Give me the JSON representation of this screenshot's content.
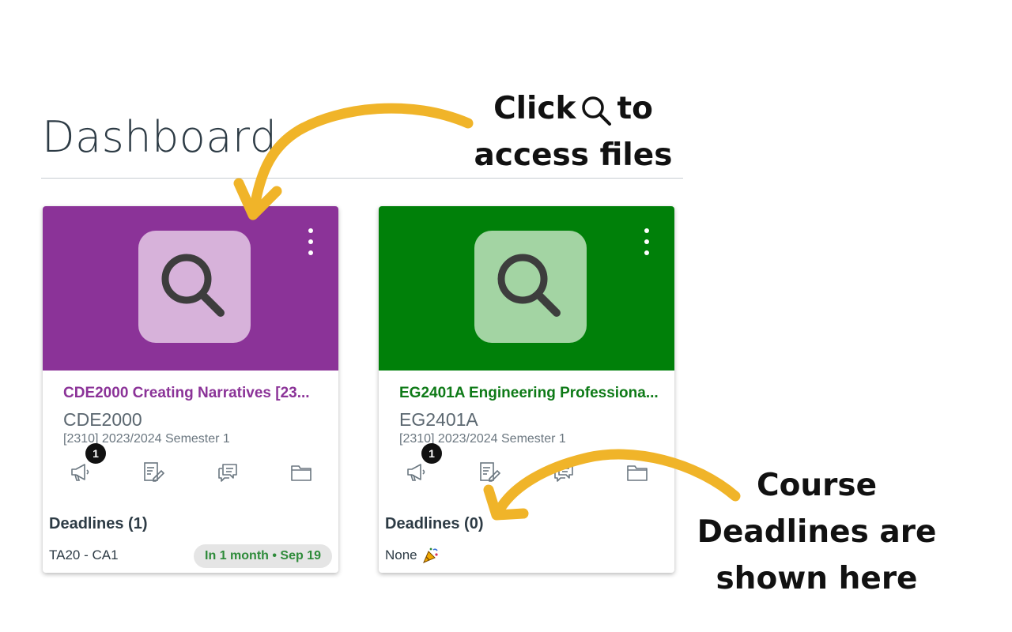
{
  "page": {
    "title": "Dashboard"
  },
  "annotations": {
    "top_line1_before": "Click",
    "top_line1_after": "to",
    "top_line2": "access files",
    "bottom_line1": "Course",
    "bottom_line2": "Deadlines are",
    "bottom_line3": "shown here",
    "arrow_color": "#f0b429"
  },
  "cards": [
    {
      "title": "CDE2000 Creating Narratives [23...",
      "code": "CDE2000",
      "term": "[2310] 2023/2024 Semester 1",
      "header_color": "#8b3398",
      "tile_color": "#d7b2da",
      "title_color": "#8b3398",
      "app_icon": "search-icon",
      "announcement_badge": "1",
      "actions": [
        "announcements-icon",
        "assignments-icon",
        "discussions-icon",
        "files-icon"
      ],
      "deadlines_heading": "Deadlines (1)",
      "deadline_item": "TA20 - CA1",
      "deadline_due": "In 1 month • Sep 19"
    },
    {
      "title": "EG2401A Engineering Professiona...",
      "code": "EG2401A",
      "term": "[2310] 2023/2024 Semester 1",
      "header_color": "#008009",
      "tile_color": "#a3d4a3",
      "title_color": "#0e7a17",
      "app_icon": "search-icon",
      "announcement_badge": "1",
      "actions": [
        "announcements-icon",
        "assignments-icon",
        "discussions-icon",
        "files-icon"
      ],
      "deadlines_heading": "Deadlines (0)",
      "deadline_none": "None",
      "none_icon": "party-popper-icon"
    }
  ]
}
